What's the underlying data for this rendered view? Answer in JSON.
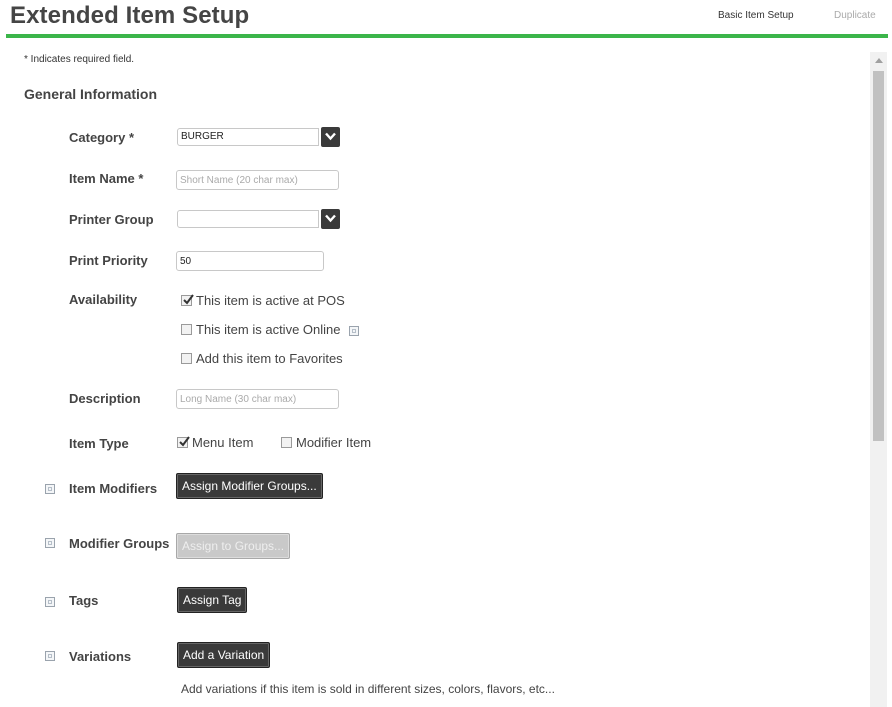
{
  "header": {
    "title": "Extended Item Setup",
    "links": {
      "basic": "Basic Item Setup",
      "duplicate": "Duplicate"
    },
    "accent_color": "#3bb54a"
  },
  "form": {
    "required_note": "* Indicates required field.",
    "section_title": "General Information",
    "category": {
      "label": "Category *",
      "value": "BURGER"
    },
    "item_name": {
      "label": "Item Name *",
      "value": "",
      "placeholder": "Short Name (20 char max)"
    },
    "printer_group": {
      "label": "Printer Group",
      "value": ""
    },
    "print_priority": {
      "label": "Print Priority",
      "value": "50"
    },
    "availability": {
      "label": "Availability",
      "options": [
        {
          "label": "This item is active at POS",
          "checked": true
        },
        {
          "label": "This item is active Online",
          "checked": false
        },
        {
          "label": "Add this item to Favorites",
          "checked": false
        }
      ]
    },
    "description": {
      "label": "Description",
      "value": "",
      "placeholder": "Long Name (30 char max)"
    },
    "item_type": {
      "label": "Item Type",
      "options": [
        {
          "label": "Menu Item",
          "checked": true
        },
        {
          "label": "Modifier Item",
          "checked": false
        }
      ]
    },
    "item_modifiers": {
      "label": "Item Modifiers",
      "button": "Assign Modifier Groups..."
    },
    "modifier_groups": {
      "label": "Modifier Groups",
      "button": "Assign to Groups..."
    },
    "tags": {
      "label": "Tags",
      "button": "Assign Tag"
    },
    "variations": {
      "label": "Variations",
      "button": "Add a Variation",
      "helper": "Add variations if this item is sold in different sizes, colors, flavors, etc..."
    }
  }
}
